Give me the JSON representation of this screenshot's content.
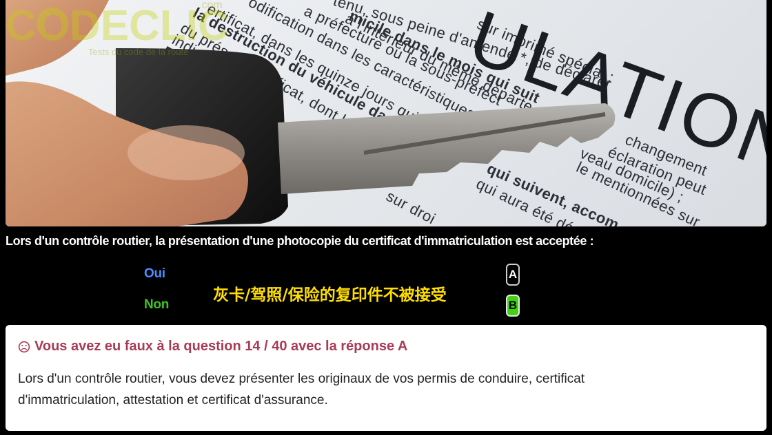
{
  "photo": {
    "title_text": "ULATION",
    "document_lines": [
      "tenu, sous peine d'amende *, de déclarer",
      "micile dans le mois qui suit",
      "à l'intérieur du même départe",
      "a préfecture ou la sous-préfect",
      "odification dans les caractéristiques",
      "ertificat, dans les quinze jours qui s",
      "la destruction du véhicule dans les",
      "du présent certificat, dont le",
      "indiqu",
      "En c",
      "sur imprimé spécial :",
      "changement",
      "éclaration peut",
      "veau domicile) ;",
      "le mentionnées sur",
      "qui suivent, accom",
      "qui aura été déco",
      "sur droi"
    ],
    "watermark": {
      "brand": "CODECLIC",
      "suffix": ".com",
      "tagline": "Tests du code de la route"
    }
  },
  "question": {
    "text": "Lors d'un contrôle routier, la présentation d'une photocopie du certificat d'immatriculation est acceptée :"
  },
  "answers": [
    {
      "label": "Oui",
      "key": "A",
      "color": "#4f8cff",
      "selected": false
    },
    {
      "label": "Non",
      "key": "B",
      "color": "#3ec41c",
      "selected": true
    }
  ],
  "annotation": "灰卡/驾照/保险的复印件不被接受",
  "result": {
    "icon": "sad-face-icon",
    "title": "Vous avez eu faux à la question 14 / 40 avec la réponse A",
    "explanation": "Lors d'un contrôle routier, vous devez présenter les originaux de vos permis de conduire, certificat d'immatriculation, attestation et certificat d'assurance."
  },
  "colors": {
    "result_title": "#a83c57",
    "annotation": "#ffde00",
    "correct_key": "#3ed40f"
  }
}
